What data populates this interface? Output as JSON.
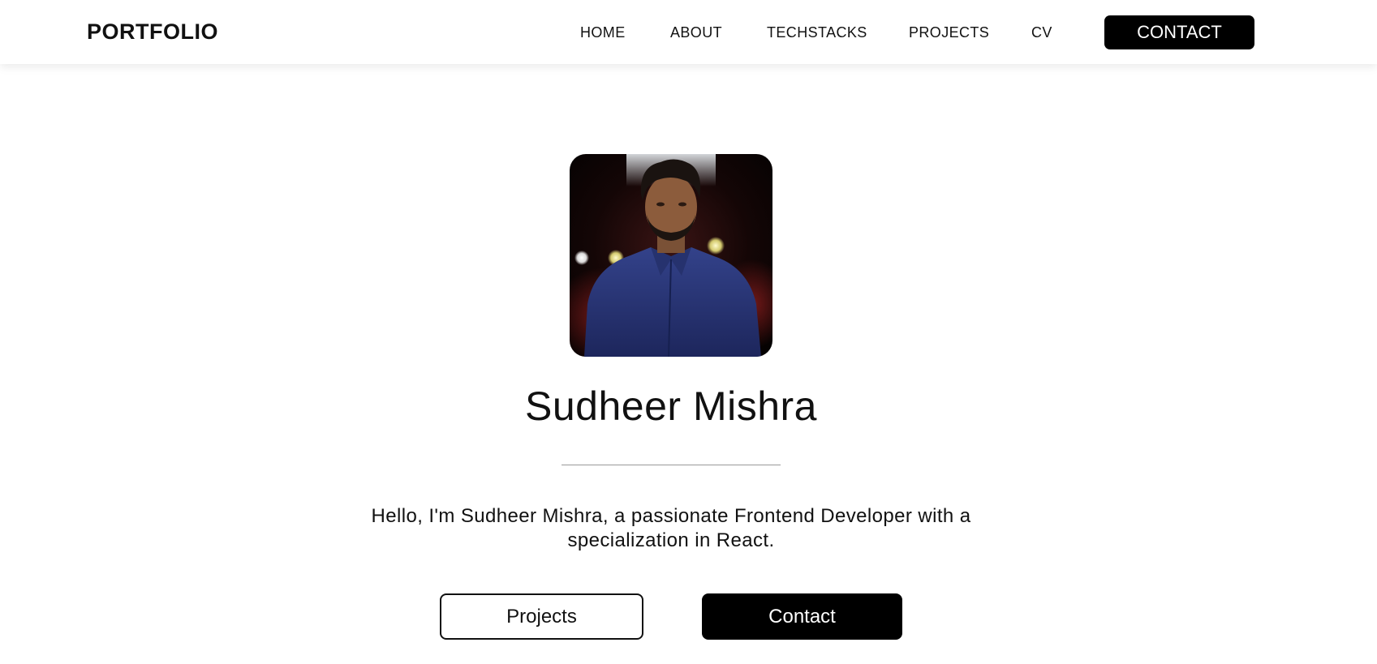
{
  "navbar": {
    "brand": "PORTFOLIO",
    "links": [
      {
        "label": "HOME"
      },
      {
        "label": "ABOUT"
      },
      {
        "label": "TECHSTACKS"
      },
      {
        "label": "PROJECTS"
      },
      {
        "label": "CV"
      }
    ],
    "cta_label": "CONTACT"
  },
  "hero": {
    "name": "Sudheer Mishra",
    "intro": "Hello, I'm Sudheer Mishra, a passionate Frontend Developer with a specialization in React.",
    "primary_button": "Projects",
    "secondary_button": "Contact"
  },
  "colors": {
    "accent": "#000000",
    "background": "#ffffff",
    "text": "#111111",
    "divider": "#9a9a9a"
  }
}
